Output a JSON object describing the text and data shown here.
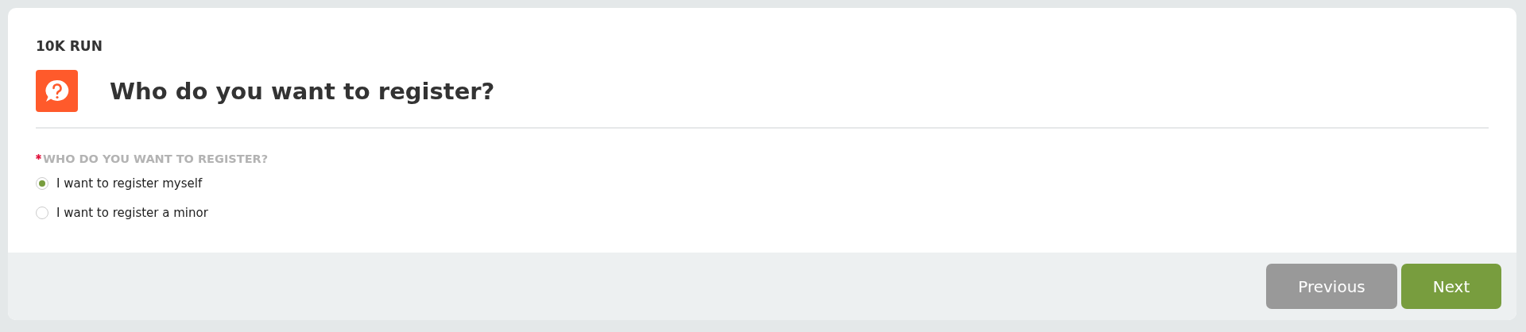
{
  "event": "10K RUN",
  "question": {
    "title": "Who do you want to register?",
    "field_label": "WHO DO YOU WANT TO REGISTER?",
    "required": true,
    "options": [
      {
        "label": "I want to register myself",
        "selected": true
      },
      {
        "label": "I want to register a minor",
        "selected": false
      }
    ]
  },
  "buttons": [
    {
      "label": "Previous",
      "kind": "secondary"
    },
    {
      "label": "Next",
      "kind": "primary"
    }
  ]
}
